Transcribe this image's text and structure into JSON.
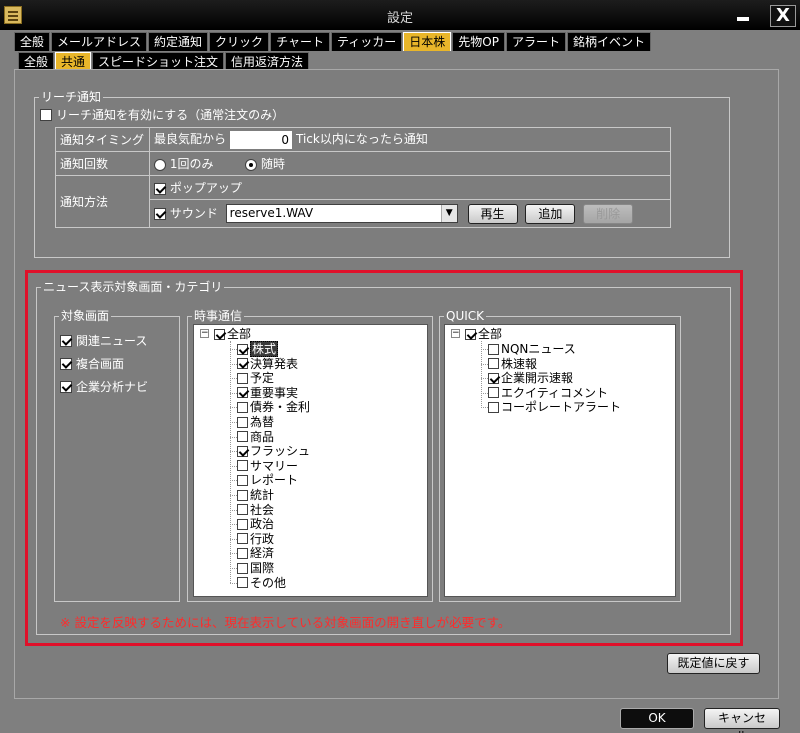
{
  "window": {
    "title": "設定",
    "close_label": "X"
  },
  "tabs_top": [
    {
      "label": "全般",
      "active": false
    },
    {
      "label": "メールアドレス",
      "active": false
    },
    {
      "label": "約定通知",
      "active": false
    },
    {
      "label": "クリック",
      "active": false
    },
    {
      "label": "チャート",
      "active": false
    },
    {
      "label": "ティッカー",
      "active": false
    },
    {
      "label": "日本株",
      "active": true
    },
    {
      "label": "先物OP",
      "active": false
    },
    {
      "label": "アラート",
      "active": false
    },
    {
      "label": "銘柄イベント",
      "active": false
    }
  ],
  "tabs_sub": [
    {
      "label": "全般",
      "active": false
    },
    {
      "label": "共通",
      "active": true
    },
    {
      "label": "スピードショット注文",
      "active": false
    },
    {
      "label": "信用返済方法",
      "active": false
    }
  ],
  "reach": {
    "legend": "リーチ通知",
    "enable_label": "リーチ通知を有効にする（通常注文のみ）",
    "enable_checked": false,
    "timing_label": "通知タイミング",
    "timing_prefix": "最良気配から",
    "timing_value": "0",
    "timing_suffix": "Tick以内になったら通知",
    "count_label": "通知回数",
    "count_once": "1回のみ",
    "count_always": "随時",
    "count_selected": "always",
    "method_label": "通知方法",
    "popup_label": "ポップアップ",
    "popup_checked": true,
    "sound_label": "サウンド",
    "sound_checked": true,
    "sound_file": "reserve1.WAV",
    "play_button": "再生",
    "add_button": "追加",
    "delete_button": "削除"
  },
  "news": {
    "legend": "ニュース表示対象画面・カテゴリ",
    "target_legend": "対象画面",
    "targets": [
      {
        "label": "関連ニュース",
        "checked": true
      },
      {
        "label": "複合画面",
        "checked": true
      },
      {
        "label": "企業分析ナビ",
        "checked": true
      }
    ],
    "jiji_legend": "時事通信",
    "jiji_root": {
      "label": "全部",
      "checked": true
    },
    "jiji_items": [
      {
        "label": "株式",
        "checked": true,
        "selected": true
      },
      {
        "label": "決算発表",
        "checked": true
      },
      {
        "label": "予定",
        "checked": false
      },
      {
        "label": "重要事実",
        "checked": true
      },
      {
        "label": "債券・金利",
        "checked": false
      },
      {
        "label": "為替",
        "checked": false
      },
      {
        "label": "商品",
        "checked": false
      },
      {
        "label": "フラッシュ",
        "checked": true
      },
      {
        "label": "サマリー",
        "checked": false
      },
      {
        "label": "レポート",
        "checked": false
      },
      {
        "label": "統計",
        "checked": false
      },
      {
        "label": "社会",
        "checked": false
      },
      {
        "label": "政治",
        "checked": false
      },
      {
        "label": "行政",
        "checked": false
      },
      {
        "label": "経済",
        "checked": false
      },
      {
        "label": "国際",
        "checked": false
      },
      {
        "label": "その他",
        "checked": false
      }
    ],
    "quick_legend": "QUICK",
    "quick_root": {
      "label": "全部",
      "checked": true
    },
    "quick_items": [
      {
        "label": "NQNニュース",
        "checked": false
      },
      {
        "label": "株速報",
        "checked": false
      },
      {
        "label": "企業開示速報",
        "checked": true
      },
      {
        "label": "エクイティコメント",
        "checked": false
      },
      {
        "label": "コーポレートアラート",
        "checked": false
      }
    ],
    "notice": "※ 設定を反映するためには、現在表示している対象画面の開き直しが必要です。"
  },
  "footer": {
    "reset_button": "既定値に戻す",
    "ok_button": "OK",
    "cancel_button": "キャンセル"
  }
}
